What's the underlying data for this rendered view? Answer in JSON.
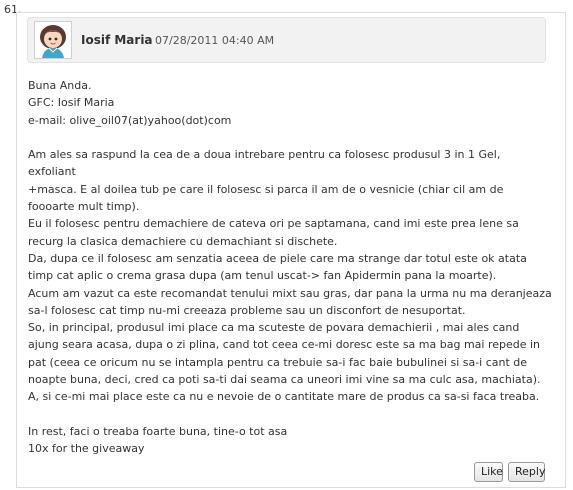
{
  "comment": {
    "number": "61.",
    "author": "Iosif Maria",
    "date": "07/28/2011 04:40 AM",
    "body_lines": [
      "Buna Anda.",
      "GFC: Iosif Maria",
      "e-mail: olive_oil07(at)yahoo(dot)com",
      "",
      "Am ales sa raspund la cea de a doua intrebare pentru ca folosesc produsul 3 in 1 Gel,",
      "exfoliant",
      "+masca. E al doilea tub pe care il folosesc si parca il am de o vesnicie (chiar cil am de",
      "foooarte mult timp).",
      "Eu il folosesc pentru demachiere de cateva ori pe saptamana, cand imi este prea lene sa",
      "recurg la  clasica demachiere cu demachiant si dischete.",
      "Da, dupa ce il folosesc am senzatia aceea de piele care ma strange dar totul este ok atata",
      "timp cat aplic o crema grasa dupa (am tenul uscat-> fan Apidermin pana la moarte).",
      "Acum am vazut ca este recomandat tenului mixt sau gras, dar pana la urma nu ma deranjeaza",
      "sa-l folosesc cat timp nu-mi creeaza probleme sau un disconfort de nesuportat.",
      "So, in principal, produsul imi place ca ma scuteste de povara demachierii , mai ales cand",
      "ajung seara acasa, dupa o zi plina, cand tot ceea ce-mi doresc este sa ma bag mai repede in",
      "pat (ceea ce oricum nu se intampla pentru ca trebuie sa-i fac baie bubulinei si sa-i cant de",
      "noapte buna, deci, cred ca poti sa-ti dai seama ca uneori imi vine sa ma culc asa, machiata).",
      "A, si ce-mi mai place este ca nu e nevoie de o cantitate mare de produs ca sa-si faca treaba.",
      "",
      "In rest, faci o treaba foarte buna, tine-o tot asa",
      "10x for the giveaway"
    ]
  },
  "actions": {
    "like_label": "Like",
    "reply_label": "Reply"
  }
}
